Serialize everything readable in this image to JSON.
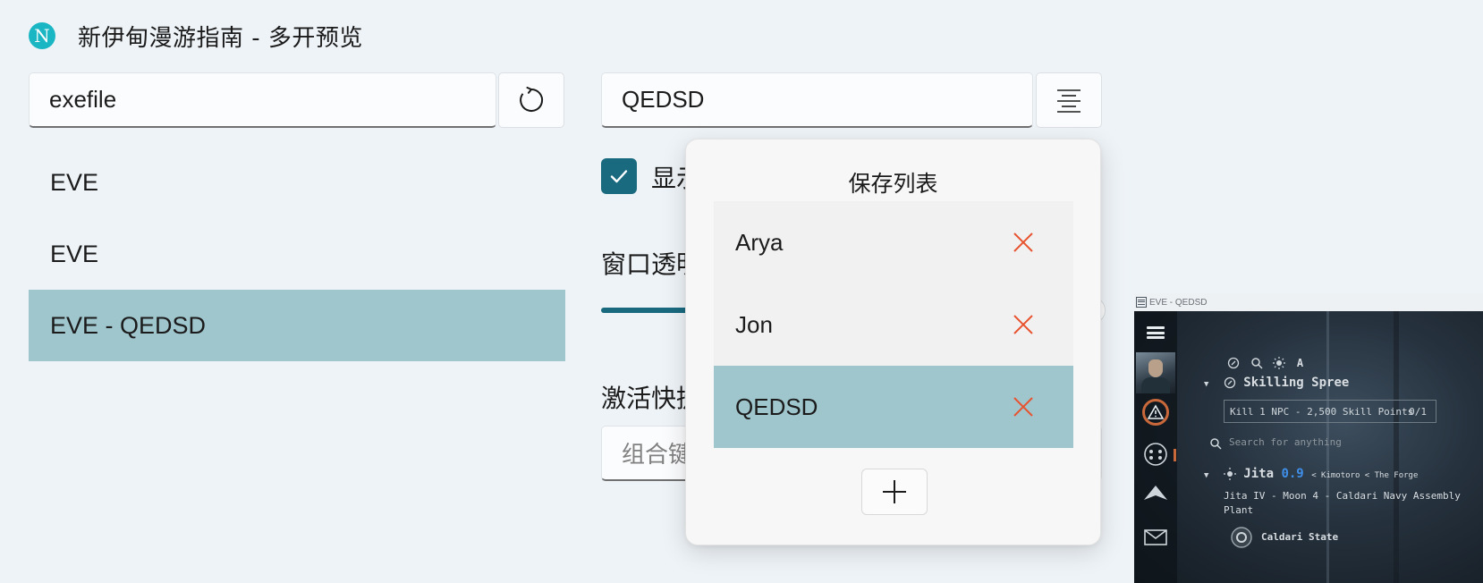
{
  "app": {
    "logo_letter": "N",
    "title": "新伊甸漫游指南 - 多开预览"
  },
  "process_filter": {
    "value": "exefile",
    "refresh_icon": "refresh-icon"
  },
  "window_list": [
    {
      "label": "EVE",
      "selected": false
    },
    {
      "label": "EVE",
      "selected": false
    },
    {
      "label": "EVE - QEDSD",
      "selected": true
    }
  ],
  "profile": {
    "value": "QEDSD",
    "list_icon": "list-icon"
  },
  "options": {
    "show_checkbox_label": "显示",
    "show_checkbox_checked": true,
    "opacity_label": "窗口透明",
    "hotkey_label": "激活快捷",
    "hotkey_placeholder": "组合键"
  },
  "save_flyout": {
    "title": "保存列表",
    "items": [
      {
        "label": "Arya",
        "selected": false
      },
      {
        "label": "Jon",
        "selected": false
      },
      {
        "label": "QEDSD",
        "selected": true
      }
    ],
    "add_icon": "plus-icon",
    "delete_icon": "close-icon"
  },
  "preview": {
    "title": "EVE - QEDSD",
    "game": {
      "toolbar_letter": "A",
      "mission_title": "Skilling Spree",
      "objective": "Kill 1 NPC - 2,500 Skill Points",
      "objective_progress": "0/1",
      "search_placeholder": "Search for anything",
      "system": "Jita",
      "security": "0.9",
      "region_path": "< Kimotoro < The Forge",
      "station_line1": "Jita IV - Moon 4 - Caldari Navy Assembly",
      "station_line2": "Plant",
      "faction": "Caldari State"
    }
  },
  "colors": {
    "accent": "#1a6a7f",
    "selection": "#9fc5cd",
    "delete": "#e8532f",
    "background": "#eef3f7",
    "logo": "#1bb6c3"
  }
}
